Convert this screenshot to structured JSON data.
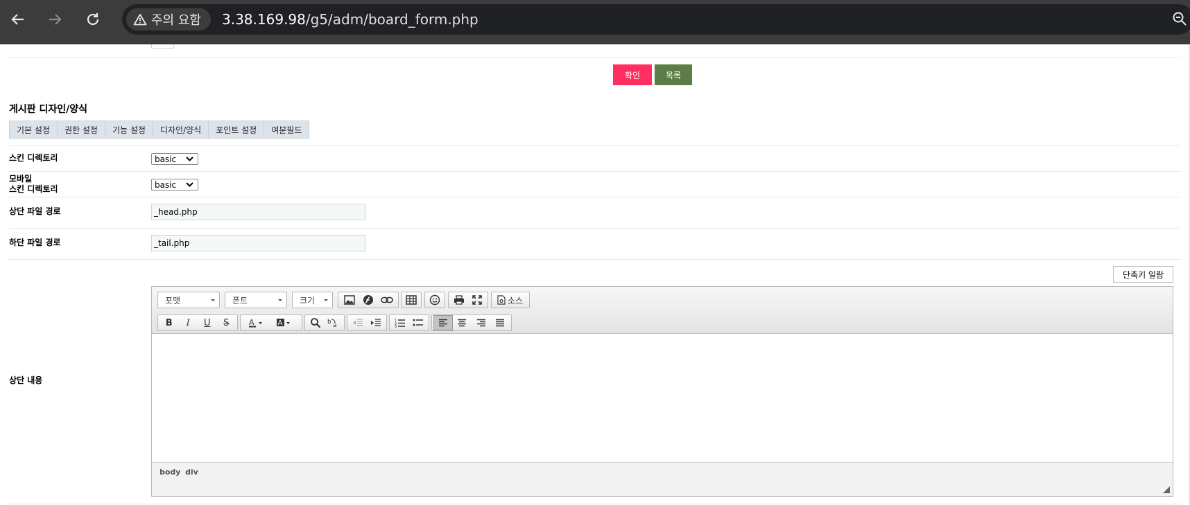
{
  "browser": {
    "security_chip": "주의 요함",
    "url_host": "3.38.169.98",
    "url_path": "/g5/adm/board_form.php"
  },
  "actions": {
    "confirm_label": "확인",
    "list_label": "목록",
    "confirm_color": "#ff3061",
    "list_color": "#5c7d45"
  },
  "section": {
    "title": "게시판 디자인/양식",
    "tabs": [
      "기본 설정",
      "권한 설정",
      "기능 설정",
      "디자인/양식",
      "포인트 설정",
      "여분필드"
    ]
  },
  "form": {
    "skin_dir": {
      "label": "스킨 디렉토리",
      "value": "basic"
    },
    "mobile_skin_dir": {
      "label_line1": "모바일",
      "label_line2": "스킨 디렉토리",
      "value": "basic"
    },
    "head_file": {
      "label": "상단 파일 경로",
      "value": "_head.php"
    },
    "tail_file": {
      "label": "하단 파일 경로",
      "value": "_tail.php"
    },
    "shortcut_label": "단축키 일람",
    "head_content_label": "상단 내용"
  },
  "editor": {
    "format_combo": "포맷",
    "font_combo": "폰트",
    "size_combo": "크기",
    "source_label": "소스",
    "path": [
      "body",
      "div"
    ],
    "toolbar_icons": [
      "image-icon",
      "flash-icon",
      "link-icon",
      "table-icon",
      "smiley-icon",
      "print-icon",
      "maximize-icon",
      "source-icon",
      "bold-icon",
      "italic-icon",
      "underline-icon",
      "strike-icon",
      "text-color-icon",
      "bg-color-icon",
      "find-icon",
      "replace-icon",
      "outdent-icon",
      "indent-icon",
      "numbered-list-icon",
      "bulleted-list-icon",
      "align-left-icon",
      "align-center-icon",
      "align-right-icon",
      "justify-icon"
    ]
  }
}
